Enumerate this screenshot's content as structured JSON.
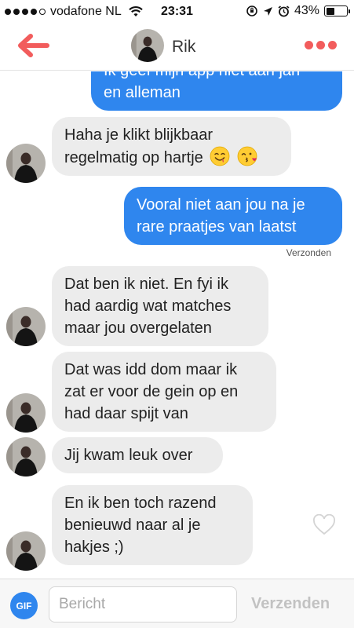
{
  "status_bar": {
    "carrier": "vodafone NL",
    "time": "23:31",
    "battery_percent": "43%",
    "battery_level": 0.43,
    "signal_bars_filled": 4,
    "signal_bars_total": 5,
    "icons": [
      "wifi-icon",
      "orientation-lock-icon",
      "location-icon",
      "alarm-icon",
      "battery-icon"
    ]
  },
  "header": {
    "contact_name": "Rik",
    "back_icon": "arrow-left-icon",
    "more_icon": "more-dots-icon",
    "accent_color": "#f25c5c"
  },
  "messages": [
    {
      "direction": "out",
      "lines": [
        "Ik geef mijn app niet aan jan",
        "en alleman"
      ]
    },
    {
      "direction": "in",
      "lines": [
        "Haha je klikt blijkbaar",
        "regelmatig op hartje"
      ],
      "emojis": [
        "smiling-face-icon",
        "face-blowing-kiss-icon"
      ]
    },
    {
      "direction": "out",
      "lines": [
        "Vooral niet aan jou na je",
        "rare praatjes van laatst"
      ]
    },
    {
      "direction": "in",
      "lines": [
        "Dat ben ik niet. En fyi ik",
        "had aardig wat matches",
        "maar jou overgelaten"
      ]
    },
    {
      "direction": "in",
      "lines": [
        "Dat was idd dom maar ik",
        "zat er voor de gein op en",
        "had daar spijt van"
      ]
    },
    {
      "direction": "in",
      "lines": [
        "Jij kwam leuk over"
      ]
    },
    {
      "direction": "in",
      "lines": [
        "En ik ben toch razend",
        "benieuwd naar al je",
        "hakjes ;)"
      ]
    }
  ],
  "delivery_status": "Verzonden",
  "colors": {
    "outgoing_bubble": "#2f86ee",
    "incoming_bubble": "#ececec"
  },
  "footer": {
    "gif_label": "GIF",
    "input_placeholder": "Bericht",
    "input_value": "",
    "send_label": "Verzenden"
  }
}
